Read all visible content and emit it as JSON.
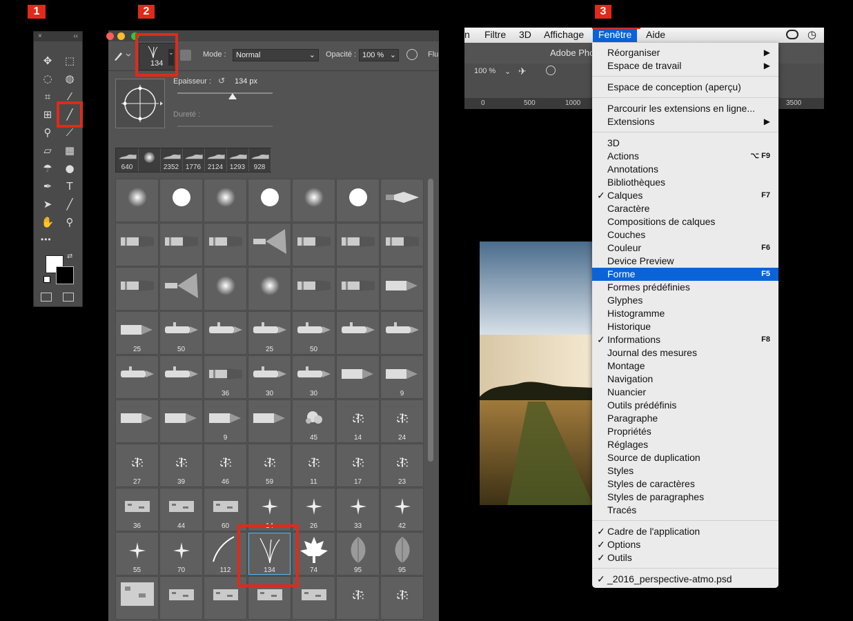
{
  "markers": [
    "1",
    "2",
    "3"
  ],
  "colors": {
    "accent_red": "#e02a1a",
    "menu_highlight": "#0a64d8"
  },
  "toolbox": {
    "close": "×",
    "collapse": "‹‹",
    "more": "•••",
    "tools": [
      "move-icon",
      "marquee-icon",
      "lasso-icon",
      "quick-select-icon",
      "crop-icon",
      "eyedropper-icon",
      "frame-icon",
      "brush-icon",
      "stamp-icon",
      "history-brush-icon",
      "eraser-icon",
      "gradient-icon",
      "blur-icon",
      "dodge-icon",
      "pen-icon",
      "type-icon",
      "path-select-icon",
      "line-icon",
      "hand-icon",
      "zoom-icon"
    ]
  },
  "brush_panel": {
    "current_size": "134",
    "mode_label": "Mode :",
    "mode_value": "Normal",
    "opacity_label": "Opacité :",
    "opacity_value": "100 %",
    "flux_label": "Flu",
    "epaisseur_label": "Epaisseur :",
    "epaisseur_value": "134 px",
    "durete_label": "Dureté :",
    "recent": [
      {
        "kind": "bristle",
        "size": "640"
      },
      {
        "kind": "soft",
        "size": ""
      },
      {
        "kind": "bristle",
        "size": "2352"
      },
      {
        "kind": "bristle",
        "size": "1776"
      },
      {
        "kind": "bristle",
        "size": "2124"
      },
      {
        "kind": "bristle",
        "size": "1293"
      },
      {
        "kind": "bristle",
        "size": "928"
      }
    ],
    "grid": [
      {
        "kind": "soft",
        "size": ""
      },
      {
        "kind": "hard",
        "size": ""
      },
      {
        "kind": "soft",
        "size": ""
      },
      {
        "kind": "hard",
        "size": ""
      },
      {
        "kind": "soft",
        "size": ""
      },
      {
        "kind": "hard",
        "size": ""
      },
      {
        "kind": "bristle-tip",
        "size": ""
      },
      {
        "kind": "flat-brush",
        "size": ""
      },
      {
        "kind": "flat-brush",
        "size": ""
      },
      {
        "kind": "flat-brush",
        "size": ""
      },
      {
        "kind": "fan-brush",
        "size": ""
      },
      {
        "kind": "flat-brush",
        "size": ""
      },
      {
        "kind": "flat-brush",
        "size": ""
      },
      {
        "kind": "flat-brush",
        "size": ""
      },
      {
        "kind": "flat-brush",
        "size": ""
      },
      {
        "kind": "fan-brush",
        "size": ""
      },
      {
        "kind": "soft",
        "size": ""
      },
      {
        "kind": "soft",
        "size": ""
      },
      {
        "kind": "flat-brush",
        "size": ""
      },
      {
        "kind": "flat-brush",
        "size": ""
      },
      {
        "kind": "pencil",
        "size": ""
      },
      {
        "kind": "pencil",
        "size": "25"
      },
      {
        "kind": "airbrush",
        "size": "50"
      },
      {
        "kind": "airbrush",
        "size": ""
      },
      {
        "kind": "airbrush",
        "size": "25"
      },
      {
        "kind": "airbrush",
        "size": "50"
      },
      {
        "kind": "airbrush",
        "size": ""
      },
      {
        "kind": "airbrush",
        "size": ""
      },
      {
        "kind": "airbrush",
        "size": ""
      },
      {
        "kind": "airbrush",
        "size": ""
      },
      {
        "kind": "flat-brush",
        "size": "36"
      },
      {
        "kind": "airbrush",
        "size": "30"
      },
      {
        "kind": "airbrush",
        "size": "30"
      },
      {
        "kind": "pencil",
        "size": ""
      },
      {
        "kind": "pencil",
        "size": "9"
      },
      {
        "kind": "pencil",
        "size": ""
      },
      {
        "kind": "pencil",
        "size": ""
      },
      {
        "kind": "pencil",
        "size": "9"
      },
      {
        "kind": "pencil",
        "size": ""
      },
      {
        "kind": "splatter",
        "size": "45"
      },
      {
        "kind": "speckle",
        "size": "14"
      },
      {
        "kind": "speckle",
        "size": "24"
      },
      {
        "kind": "speckle",
        "size": "27"
      },
      {
        "kind": "speckle",
        "size": "39"
      },
      {
        "kind": "speckle",
        "size": "46"
      },
      {
        "kind": "speckle",
        "size": "59"
      },
      {
        "kind": "speckle",
        "size": "11"
      },
      {
        "kind": "speckle",
        "size": "17"
      },
      {
        "kind": "speckle",
        "size": "23"
      },
      {
        "kind": "chalk",
        "size": "36"
      },
      {
        "kind": "chalk",
        "size": "44"
      },
      {
        "kind": "chalk",
        "size": "60"
      },
      {
        "kind": "star",
        "size": "14"
      },
      {
        "kind": "star",
        "size": "26"
      },
      {
        "kind": "star",
        "size": "33"
      },
      {
        "kind": "star",
        "size": "42"
      },
      {
        "kind": "star",
        "size": "55"
      },
      {
        "kind": "star",
        "size": "70"
      },
      {
        "kind": "stroke",
        "size": "112"
      },
      {
        "kind": "grass",
        "size": "134"
      },
      {
        "kind": "maple-leaf",
        "size": "74"
      },
      {
        "kind": "leaf",
        "size": "95"
      },
      {
        "kind": "leaf",
        "size": "95"
      },
      {
        "kind": "texture",
        "size": ""
      },
      {
        "kind": "chalk",
        "size": ""
      },
      {
        "kind": "chalk",
        "size": ""
      },
      {
        "kind": "chalk",
        "size": ""
      },
      {
        "kind": "chalk",
        "size": ""
      },
      {
        "kind": "speckle",
        "size": ""
      },
      {
        "kind": "speckle",
        "size": ""
      }
    ]
  },
  "menubar": {
    "items": [
      "n",
      "Filtre",
      "3D",
      "Affichage",
      "Fenêtre",
      "Aide"
    ],
    "app_title": "Adobe Pho",
    "opacity": "100 %",
    "ruler": [
      "0",
      "500",
      "1000",
      "3500"
    ]
  },
  "menu": {
    "items": [
      {
        "label": "Réorganiser",
        "shortcut": "",
        "check": false,
        "arrow": true,
        "hl": false
      },
      {
        "label": "Espace de travail",
        "shortcut": "",
        "check": false,
        "arrow": true,
        "hl": false
      },
      {
        "sep": true
      },
      {
        "label": "Espace de conception (aperçu)",
        "shortcut": "",
        "check": false,
        "arrow": false,
        "hl": false
      },
      {
        "sep": true
      },
      {
        "label": "Parcourir les extensions en ligne...",
        "shortcut": "",
        "check": false,
        "arrow": false,
        "hl": false
      },
      {
        "label": "Extensions",
        "shortcut": "",
        "check": false,
        "arrow": true,
        "hl": false
      },
      {
        "sep": true
      },
      {
        "label": "3D",
        "shortcut": "",
        "check": false,
        "arrow": false,
        "hl": false
      },
      {
        "label": "Actions",
        "shortcut": "⌥ F9",
        "check": false,
        "arrow": false,
        "hl": false
      },
      {
        "label": "Annotations",
        "shortcut": "",
        "check": false,
        "arrow": false,
        "hl": false
      },
      {
        "label": "Bibliothèques",
        "shortcut": "",
        "check": false,
        "arrow": false,
        "hl": false
      },
      {
        "label": "Calques",
        "shortcut": "F7",
        "check": true,
        "arrow": false,
        "hl": false
      },
      {
        "label": "Caractère",
        "shortcut": "",
        "check": false,
        "arrow": false,
        "hl": false
      },
      {
        "label": "Compositions de calques",
        "shortcut": "",
        "check": false,
        "arrow": false,
        "hl": false
      },
      {
        "label": "Couches",
        "shortcut": "",
        "check": false,
        "arrow": false,
        "hl": false
      },
      {
        "label": "Couleur",
        "shortcut": "F6",
        "check": false,
        "arrow": false,
        "hl": false
      },
      {
        "label": "Device Preview",
        "shortcut": "",
        "check": false,
        "arrow": false,
        "hl": false
      },
      {
        "label": "Forme",
        "shortcut": "F5",
        "check": false,
        "arrow": false,
        "hl": true
      },
      {
        "label": "Formes prédéfinies",
        "shortcut": "",
        "check": false,
        "arrow": false,
        "hl": false
      },
      {
        "label": "Glyphes",
        "shortcut": "",
        "check": false,
        "arrow": false,
        "hl": false
      },
      {
        "label": "Histogramme",
        "shortcut": "",
        "check": false,
        "arrow": false,
        "hl": false
      },
      {
        "label": "Historique",
        "shortcut": "",
        "check": false,
        "arrow": false,
        "hl": false
      },
      {
        "label": "Informations",
        "shortcut": "F8",
        "check": true,
        "arrow": false,
        "hl": false
      },
      {
        "label": "Journal des mesures",
        "shortcut": "",
        "check": false,
        "arrow": false,
        "hl": false
      },
      {
        "label": "Montage",
        "shortcut": "",
        "check": false,
        "arrow": false,
        "hl": false
      },
      {
        "label": "Navigation",
        "shortcut": "",
        "check": false,
        "arrow": false,
        "hl": false
      },
      {
        "label": "Nuancier",
        "shortcut": "",
        "check": false,
        "arrow": false,
        "hl": false
      },
      {
        "label": "Outils prédéfinis",
        "shortcut": "",
        "check": false,
        "arrow": false,
        "hl": false
      },
      {
        "label": "Paragraphe",
        "shortcut": "",
        "check": false,
        "arrow": false,
        "hl": false
      },
      {
        "label": "Propriétés",
        "shortcut": "",
        "check": false,
        "arrow": false,
        "hl": false
      },
      {
        "label": "Réglages",
        "shortcut": "",
        "check": false,
        "arrow": false,
        "hl": false
      },
      {
        "label": "Source de duplication",
        "shortcut": "",
        "check": false,
        "arrow": false,
        "hl": false
      },
      {
        "label": "Styles",
        "shortcut": "",
        "check": false,
        "arrow": false,
        "hl": false
      },
      {
        "label": "Styles de caractères",
        "shortcut": "",
        "check": false,
        "arrow": false,
        "hl": false
      },
      {
        "label": "Styles de paragraphes",
        "shortcut": "",
        "check": false,
        "arrow": false,
        "hl": false
      },
      {
        "label": "Tracés",
        "shortcut": "",
        "check": false,
        "arrow": false,
        "hl": false
      },
      {
        "sep": true
      },
      {
        "label": "Cadre de l'application",
        "shortcut": "",
        "check": true,
        "arrow": false,
        "hl": false
      },
      {
        "label": "Options",
        "shortcut": "",
        "check": true,
        "arrow": false,
        "hl": false
      },
      {
        "label": "Outils",
        "shortcut": "",
        "check": true,
        "arrow": false,
        "hl": false
      },
      {
        "sep": true
      },
      {
        "label": "_2016_perspective-atmo.psd",
        "shortcut": "",
        "check": true,
        "arrow": false,
        "hl": false
      }
    ]
  }
}
